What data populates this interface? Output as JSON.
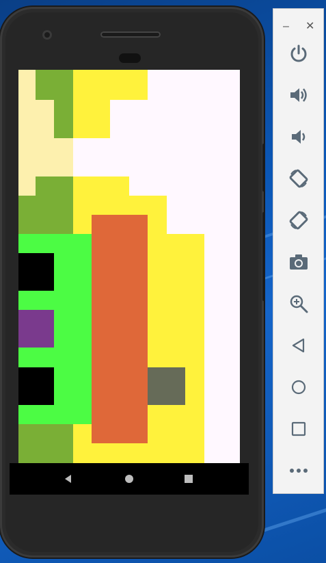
{
  "window": {
    "minimize_glyph": "–",
    "close_glyph": "✕"
  },
  "toolbar": {
    "items": [
      {
        "name": "power-button",
        "icon": "power-icon"
      },
      {
        "name": "volume-up-button",
        "icon": "volume-up-icon"
      },
      {
        "name": "volume-down-button",
        "icon": "volume-down-icon"
      },
      {
        "name": "rotate-left-button",
        "icon": "rotate-left-icon"
      },
      {
        "name": "rotate-right-button",
        "icon": "rotate-right-icon"
      },
      {
        "name": "screenshot-button",
        "icon": "camera-icon"
      },
      {
        "name": "zoom-button",
        "icon": "zoom-in-icon"
      },
      {
        "name": "back-button",
        "icon": "triangle-back-icon"
      },
      {
        "name": "home-button",
        "icon": "circle-home-icon"
      },
      {
        "name": "overview-button",
        "icon": "square-overview-icon"
      },
      {
        "name": "more-button",
        "icon": "more-dots-icon"
      }
    ],
    "icon_color": "#5a6a78"
  },
  "device_nav": {
    "buttons": [
      "back-icon",
      "home-icon",
      "recents-icon"
    ]
  },
  "screen": {
    "background": "#fff8ff",
    "colors": {
      "pale_yellow": "#fdf0ae",
      "olive_green": "#7aaf36",
      "yellow": "#fff23c",
      "bright_green": "#4cfc44",
      "orange": "#df6839",
      "black": "#000000",
      "purple": "#7a3a8d",
      "gray": "#666b58"
    }
  }
}
